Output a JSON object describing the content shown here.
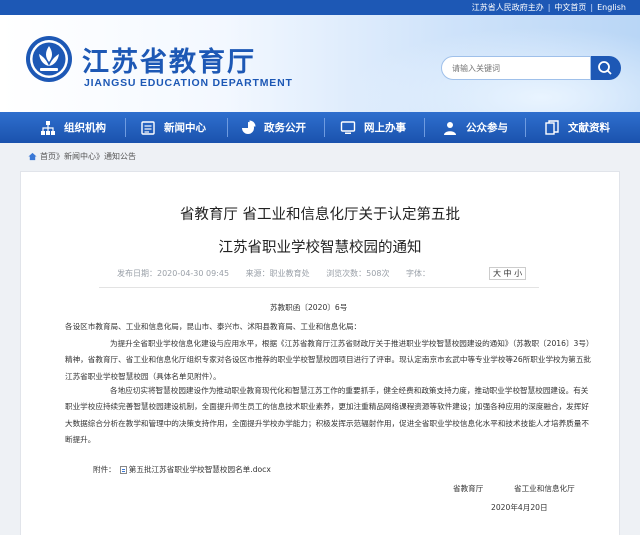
{
  "topbar": {
    "host": "江苏省人民政府主办",
    "home": "中文首页",
    "english": "English"
  },
  "header": {
    "title_cn": "江苏省教育厅",
    "title_en": "JIANGSU EDUCATION DEPARTMENT",
    "search_placeholder": "请输入关键词"
  },
  "nav": {
    "items": [
      {
        "label": "组织机构",
        "icon": "org-icon"
      },
      {
        "label": "新闻中心",
        "icon": "news-icon"
      },
      {
        "label": "政务公开",
        "icon": "gov-icon"
      },
      {
        "label": "网上办事",
        "icon": "online-icon"
      },
      {
        "label": "公众参与",
        "icon": "public-icon"
      },
      {
        "label": "文献资料",
        "icon": "docs-icon"
      }
    ]
  },
  "breadcrumb": {
    "home": "首页",
    "sep1": "》",
    "level1": "新闻中心",
    "sep2": "》",
    "level2": "通知公告"
  },
  "article": {
    "title_line1": "省教育厅 省工业和信息化厅关于认定第五批",
    "title_line2": "江苏省职业学校智慧校园的通知",
    "meta_date": "发布日期：2020-04-30 09:45",
    "meta_source": "来源：职业教育处",
    "meta_views": "浏览次数：508次",
    "font_label": "字体：",
    "font_big": "大",
    "font_mid": "中",
    "font_small": "小",
    "doc_no": "苏教职函〔2020〕6号",
    "addressee": "各设区市教育局、工业和信息化局，昆山市、泰兴市、沭阳县教育局、工业和信息化局：",
    "para1": "为提升全省职业学校信息化建设与应用水平，根据《江苏省教育厅江苏省财政厅关于推进职业学校智慧校园建设的通知》（苏教职〔2016〕3号）精神，省教育厅、省工业和信息化厅组织专家对各设区市推荐的职业学校智慧校园项目进行了评审。现认定南京市玄武中等专业学校等26所职业学校为第五批江苏省职业学校智慧校园（具体名单见附件）。",
    "para2": "各地应切实将智慧校园建设作为推动职业教育现代化和智慧江苏工作的重要抓手，健全经费和政策支持力度，推动职业学校智慧校园建设。有关职业学校应持续完善智慧校园建设机制，全面提升师生员工的信息技术职业素养，更加注重精品网络课程资源等软件建设；加强各种应用的深度融合，发挥好大数据综合分析在教学和管理中的决策支持作用，全面提升学校办学能力；积极发挥示范辐射作用，促进全省职业学校信息化水平和技术技能人才培养质量不断提升。",
    "attachment_label": "附件：",
    "attachment_file": "第五批江苏省职业学校智慧校园名单.docx",
    "sign1": "省教育厅",
    "sign2": "省工业和信息化厅",
    "date": "2020年4月20日"
  },
  "colors": {
    "brand_blue": "#1d58b5",
    "nav_blue": "#2565c4"
  }
}
